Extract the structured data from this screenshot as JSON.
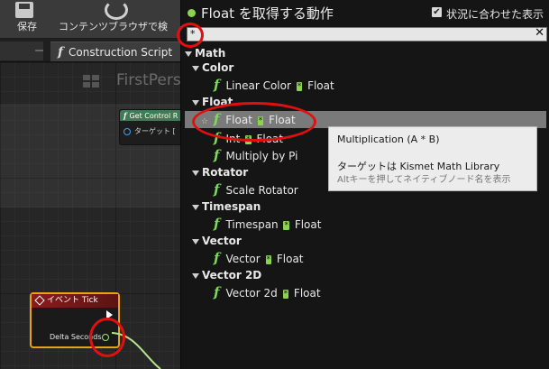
{
  "toolbar": {
    "save_label": "保存",
    "browse_label": "コンテンツブラウザで検"
  },
  "tabs": {
    "stub_close": "ー",
    "construction_script": "Construction Script"
  },
  "graph": {
    "title": "FirstPers",
    "node_get_control": {
      "title": "Get Control R",
      "target_label": "ターゲット ["
    },
    "node_event_tick": {
      "title": "イベント Tick",
      "delta_seconds": "Delta Seconds"
    }
  },
  "menu": {
    "title": "Float を取得する動作",
    "context_sensitive_label": "状況に合わせた表示",
    "context_sensitive_checked": true,
    "search_value": "*",
    "categories": [
      {
        "label": "Math",
        "items": []
      },
      {
        "label": "Color",
        "items": [
          {
            "left": "Linear Color",
            "op": "*",
            "right": "Float"
          }
        ]
      },
      {
        "label": "Float",
        "items": [
          {
            "left": "Float",
            "op": "*",
            "right": "Float",
            "selected": true
          },
          {
            "left": "Int",
            "op": "*",
            "right": "Float"
          },
          {
            "left": "Multiply by Pi",
            "op": "",
            "right": ""
          }
        ]
      },
      {
        "label": "Rotator",
        "items": [
          {
            "left": "Scale Rotator",
            "op": "",
            "right": ""
          }
        ]
      },
      {
        "label": "Timespan",
        "items": [
          {
            "left": "Timespan",
            "op": "*",
            "right": "Float"
          }
        ]
      },
      {
        "label": "Vector",
        "items": [
          {
            "left": "Vector",
            "op": "*",
            "right": "Float"
          }
        ]
      },
      {
        "label": "Vector 2D",
        "items": [
          {
            "left": "Vector 2d",
            "op": "*",
            "right": "Float"
          }
        ]
      }
    ],
    "tooltip": {
      "line1": "Multiplication (A * B)",
      "line2": "ターゲットは Kismet Math Library",
      "line3": "Altキーを押してネイティブノード名を表示"
    }
  },
  "colors": {
    "accent_green": "#8bd34e",
    "function_icon_green": "#7ed95a",
    "annotation_red": "#e01010",
    "event_border": "#e6a21a"
  }
}
